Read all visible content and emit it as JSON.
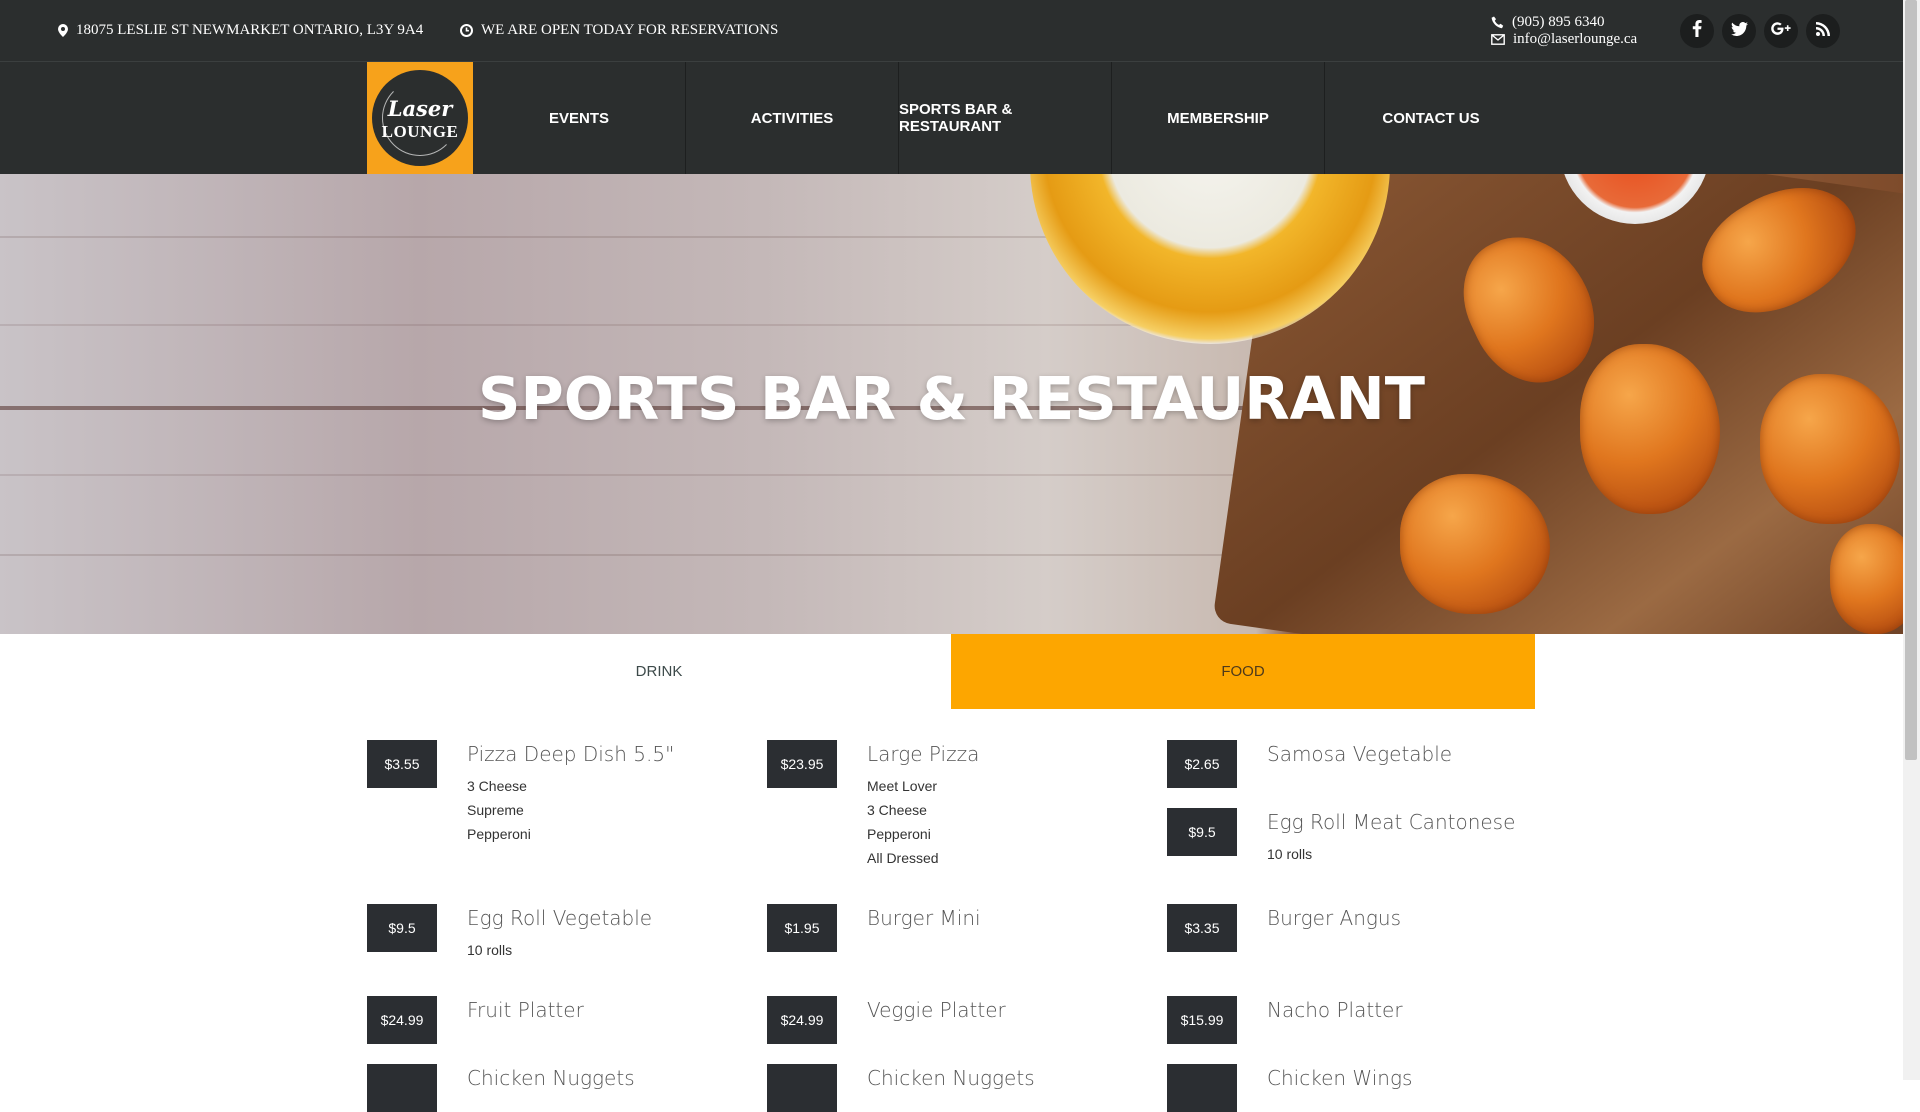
{
  "topbar": {
    "address": "18075 LESLIE ST NEWMARKET ONTARIO, L3Y 9A4",
    "hours": "WE ARE OPEN TODAY FOR RESERVATIONS",
    "phone": "(905) 895 6340",
    "email": "info@laserlounge.ca",
    "social": [
      {
        "icon": "facebook-icon",
        "glyph": "f"
      },
      {
        "icon": "twitter-icon",
        "glyph": "🐦"
      },
      {
        "icon": "google-plus-icon",
        "glyph": "g+"
      },
      {
        "icon": "rss-icon",
        "glyph": "rss"
      }
    ]
  },
  "logo": {
    "line1": "Laser",
    "line2": "LOUNGE"
  },
  "nav": {
    "items": [
      "EVENTS",
      "ACTIVITIES",
      "SPORTS BAR & RESTAURANT",
      "MEMBERSHIP",
      "CONTACT US"
    ]
  },
  "hero": {
    "title": "SPORTS BAR & RESTAURANT"
  },
  "tabs": {
    "drink": "DRINK",
    "food": "FOOD",
    "active": "FOOD"
  },
  "colors": {
    "accent": "#fda600",
    "dark": "#2b2e2e",
    "price_bg": "#2b2e32"
  },
  "menu": [
    {
      "price": "$3.55",
      "name": "Pizza Deep Dish 5.5\"",
      "desc": [
        "3 Cheese",
        "Supreme",
        "Pepperoni"
      ]
    },
    {
      "price": "$23.95",
      "name": "Large Pizza",
      "desc": [
        "Meet Lover",
        "3 Cheese",
        "Pepperoni",
        "All Dressed"
      ]
    },
    {
      "price": "$2.65",
      "name": "Samosa Vegetable",
      "desc": []
    },
    {
      "price": "$9.5",
      "name": "Egg Roll Meat Cantonese",
      "desc": [
        "10 rolls"
      ]
    },
    {
      "price": "$9.5",
      "name": "Egg Roll Vegetable",
      "desc": [
        "10 rolls"
      ]
    },
    {
      "price": "$1.95",
      "name": "Burger Mini",
      "desc": []
    },
    {
      "price": "$3.35",
      "name": "Burger Angus",
      "desc": []
    },
    {
      "price": "$24.99",
      "name": "Fruit Platter",
      "desc": []
    },
    {
      "price": "$24.99",
      "name": "Veggie Platter",
      "desc": []
    },
    {
      "price": "$15.99",
      "name": "Nacho Platter",
      "desc": []
    },
    {
      "price": "",
      "name": "Chicken Nuggets",
      "desc": []
    },
    {
      "price": "",
      "name": "Chicken Nuggets",
      "desc": []
    },
    {
      "price": "",
      "name": "Chicken Wings",
      "desc": []
    }
  ]
}
